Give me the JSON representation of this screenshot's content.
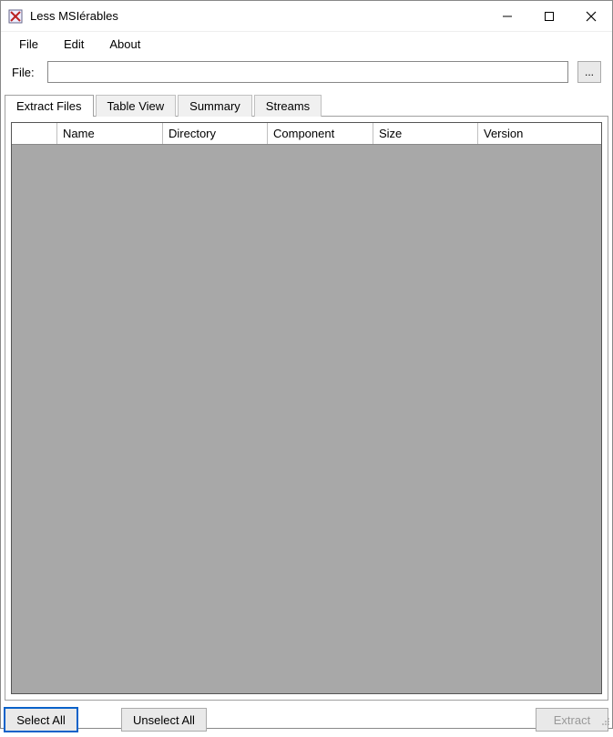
{
  "window": {
    "title": "Less MSIérables"
  },
  "menu": {
    "file": "File",
    "edit": "Edit",
    "about": "About"
  },
  "file_row": {
    "label": "File:",
    "value": "",
    "browse": "..."
  },
  "tabs": {
    "extract": "Extract Files",
    "table": "Table View",
    "summary": "Summary",
    "streams": "Streams"
  },
  "grid": {
    "columns": {
      "name": "Name",
      "directory": "Directory",
      "component": "Component",
      "size": "Size",
      "version": "Version"
    }
  },
  "buttons": {
    "select_all": "Select All",
    "unselect_all": "Unselect All",
    "extract": "Extract"
  }
}
